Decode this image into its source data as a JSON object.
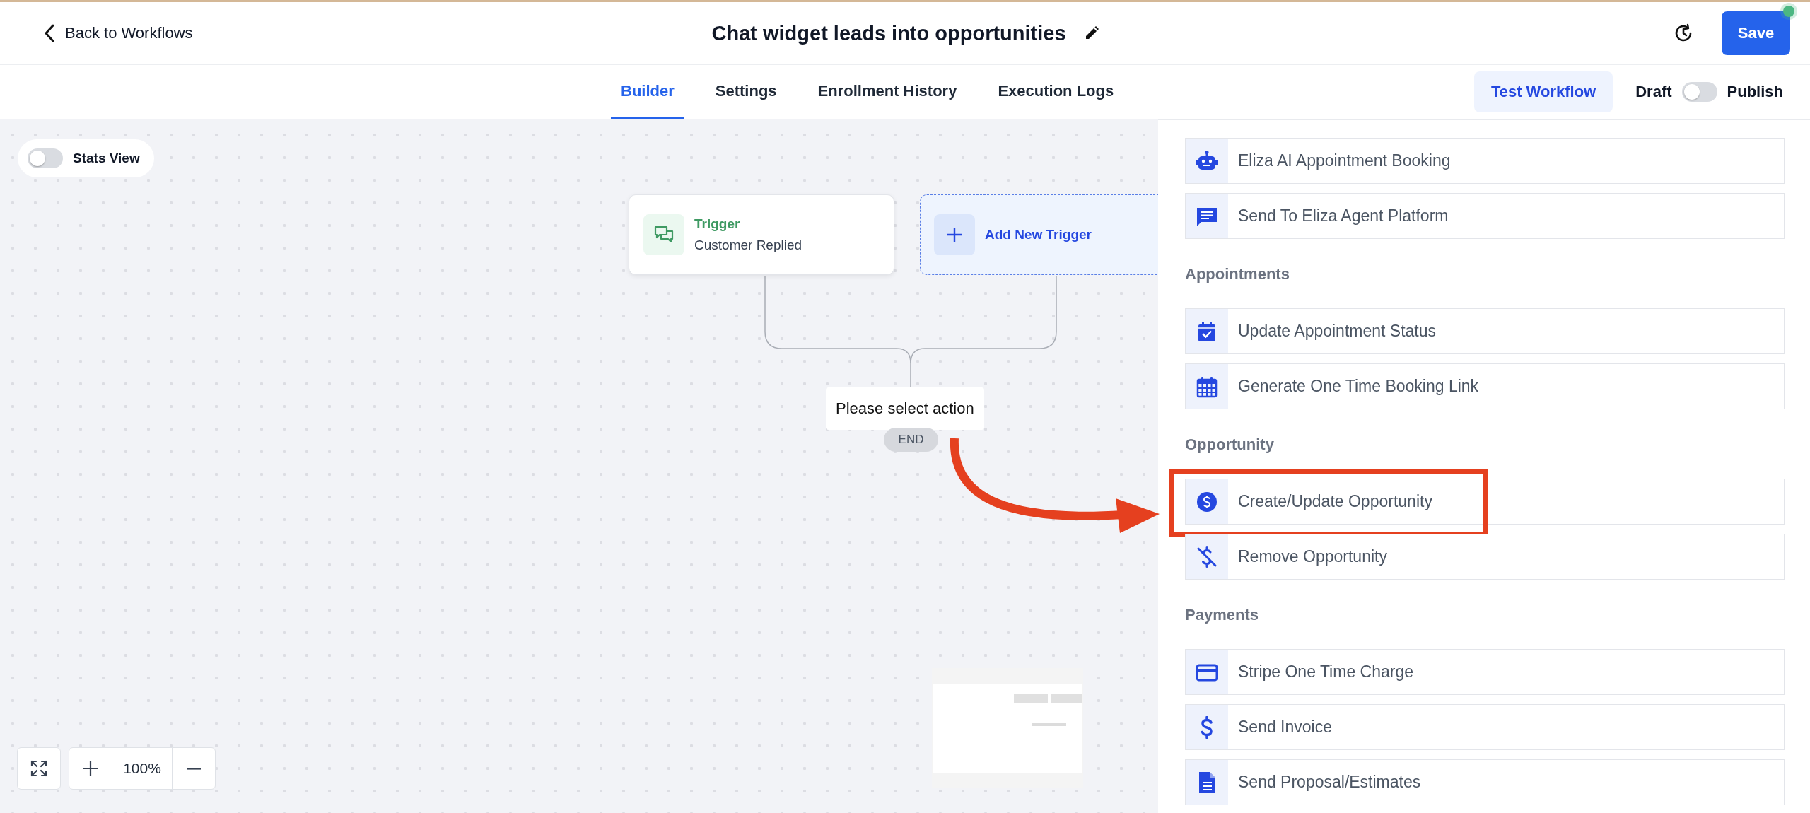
{
  "header": {
    "back_link": "Back to Workflows",
    "title": "Chat widget leads into opportunities",
    "save_button": "Save"
  },
  "tabs": [
    {
      "label": "Builder",
      "selected": true
    },
    {
      "label": "Settings",
      "selected": false
    },
    {
      "label": "Enrollment History",
      "selected": false
    },
    {
      "label": "Execution Logs",
      "selected": false
    }
  ],
  "test_button": "Test Workflow",
  "publish_toggle": {
    "off_label": "Draft",
    "on_label": "Publish",
    "on": false
  },
  "canvas": {
    "stats_toggle": {
      "label": "Stats View",
      "on": false
    },
    "trigger": {
      "title": "Trigger",
      "event": "Customer Replied"
    },
    "add_trigger": "Add New Trigger",
    "action_placeholder": "Please select action",
    "end_label": "END",
    "zoom_level": "100%"
  },
  "actions_panel": {
    "groups": [
      {
        "items": [
          {
            "label": "Eliza AI Appointment Booking",
            "kind": "robot",
            "highlighted": false
          },
          {
            "label": "Send To Eliza Agent Platform",
            "kind": "chat",
            "highlighted": false
          }
        ]
      },
      {
        "heading": "Appointments",
        "items": [
          {
            "label": "Update Appointment Status",
            "kind": "calendar-check",
            "highlighted": false
          },
          {
            "label": "Generate One Time Booking Link",
            "kind": "calendar",
            "highlighted": false
          }
        ]
      },
      {
        "heading": "Opportunity",
        "items": [
          {
            "label": "Create/Update Opportunity",
            "kind": "dollar-circle",
            "highlighted": true
          },
          {
            "label": "Remove Opportunity",
            "kind": "dollar-off",
            "highlighted": false
          }
        ]
      },
      {
        "heading": "Payments",
        "items": [
          {
            "label": "Stripe One Time Charge",
            "kind": "card",
            "highlighted": false
          },
          {
            "label": "Send Invoice",
            "kind": "dollar",
            "highlighted": false
          },
          {
            "label": "Send Proposal/Estimates",
            "kind": "document",
            "highlighted": false
          }
        ]
      }
    ]
  }
}
